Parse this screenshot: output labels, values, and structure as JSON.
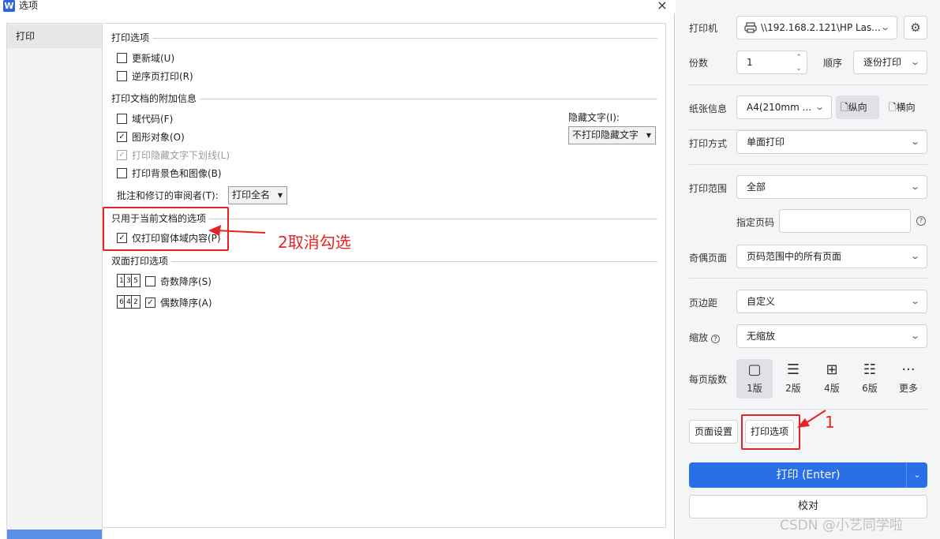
{
  "dialog": {
    "app_logo": "W",
    "title": "选项",
    "close": "×",
    "categories": [
      {
        "label": "打印"
      }
    ]
  },
  "print_options": {
    "header": "打印选项",
    "update_fields": {
      "label": "更新域(U)",
      "checked": false
    },
    "reverse_order": {
      "label": "逆序页打印(R)",
      "checked": false
    }
  },
  "extra_info": {
    "header": "打印文档的附加信息",
    "field_codes": {
      "label": "域代码(F)",
      "checked": false
    },
    "drawing_objects": {
      "label": "图形对象(O)",
      "checked": true
    },
    "hidden_underline": {
      "label": "打印隐藏文字下划线(L)",
      "checked": true,
      "disabled": true
    },
    "background": {
      "label": "打印背景色和图像(B)",
      "checked": false
    },
    "hidden_text_label": "隐藏文字(I):",
    "hidden_text_value": "不打印隐藏文字",
    "reviewer_label": "批注和修订的审阅者(T):",
    "reviewer_value": "打印全名"
  },
  "current_doc": {
    "header": "只用于当前文档的选项",
    "form_fields_only": {
      "label": "仅打印窗体域内容(P)",
      "checked": true
    }
  },
  "duplex": {
    "header": "双面打印选项",
    "odd_icon_pages": [
      "1",
      "3",
      "5"
    ],
    "even_icon_pages": [
      "6",
      "4",
      "2"
    ],
    "odd_desc": {
      "label": "奇数降序(S)",
      "checked": false
    },
    "even_desc": {
      "label": "偶数降序(A)",
      "checked": true
    }
  },
  "annotations": {
    "step2": "2取消勾选",
    "step1": "1",
    "color": "#e52323"
  },
  "panel": {
    "printer_label": "打印机",
    "printer_value": "\\\\192.168.2.121\\HP Las...",
    "copies_label": "份数",
    "copies_value": "1",
    "order_label": "顺序",
    "order_value": "逐份打印",
    "paper_label": "纸张信息",
    "paper_value": "A4(210mm ...",
    "portrait": "纵向",
    "landscape": "横向",
    "method_label": "打印方式",
    "method_value": "单面打印",
    "range_label": "打印范围",
    "range_value": "全部",
    "pages_label": "指定页码",
    "pages_value": "",
    "odd_even_label": "奇偶页面",
    "odd_even_value": "页码范围中的所有页面",
    "margin_label": "页边距",
    "margin_value": "自定义",
    "zoom_label": "缩放",
    "zoom_value": "无缩放",
    "per_page_label": "每页版数",
    "per_page_options": [
      {
        "label": "1版"
      },
      {
        "label": "2版"
      },
      {
        "label": "4版"
      },
      {
        "label": "6版"
      },
      {
        "label": "更多"
      }
    ],
    "page_setup": "页面设置",
    "print_options_btn": "打印选项",
    "print_button": "打印 (Enter)",
    "proof_button": "校对",
    "accent": "#2b6fe8"
  },
  "watermark": "CSDN @小艺同学啦"
}
